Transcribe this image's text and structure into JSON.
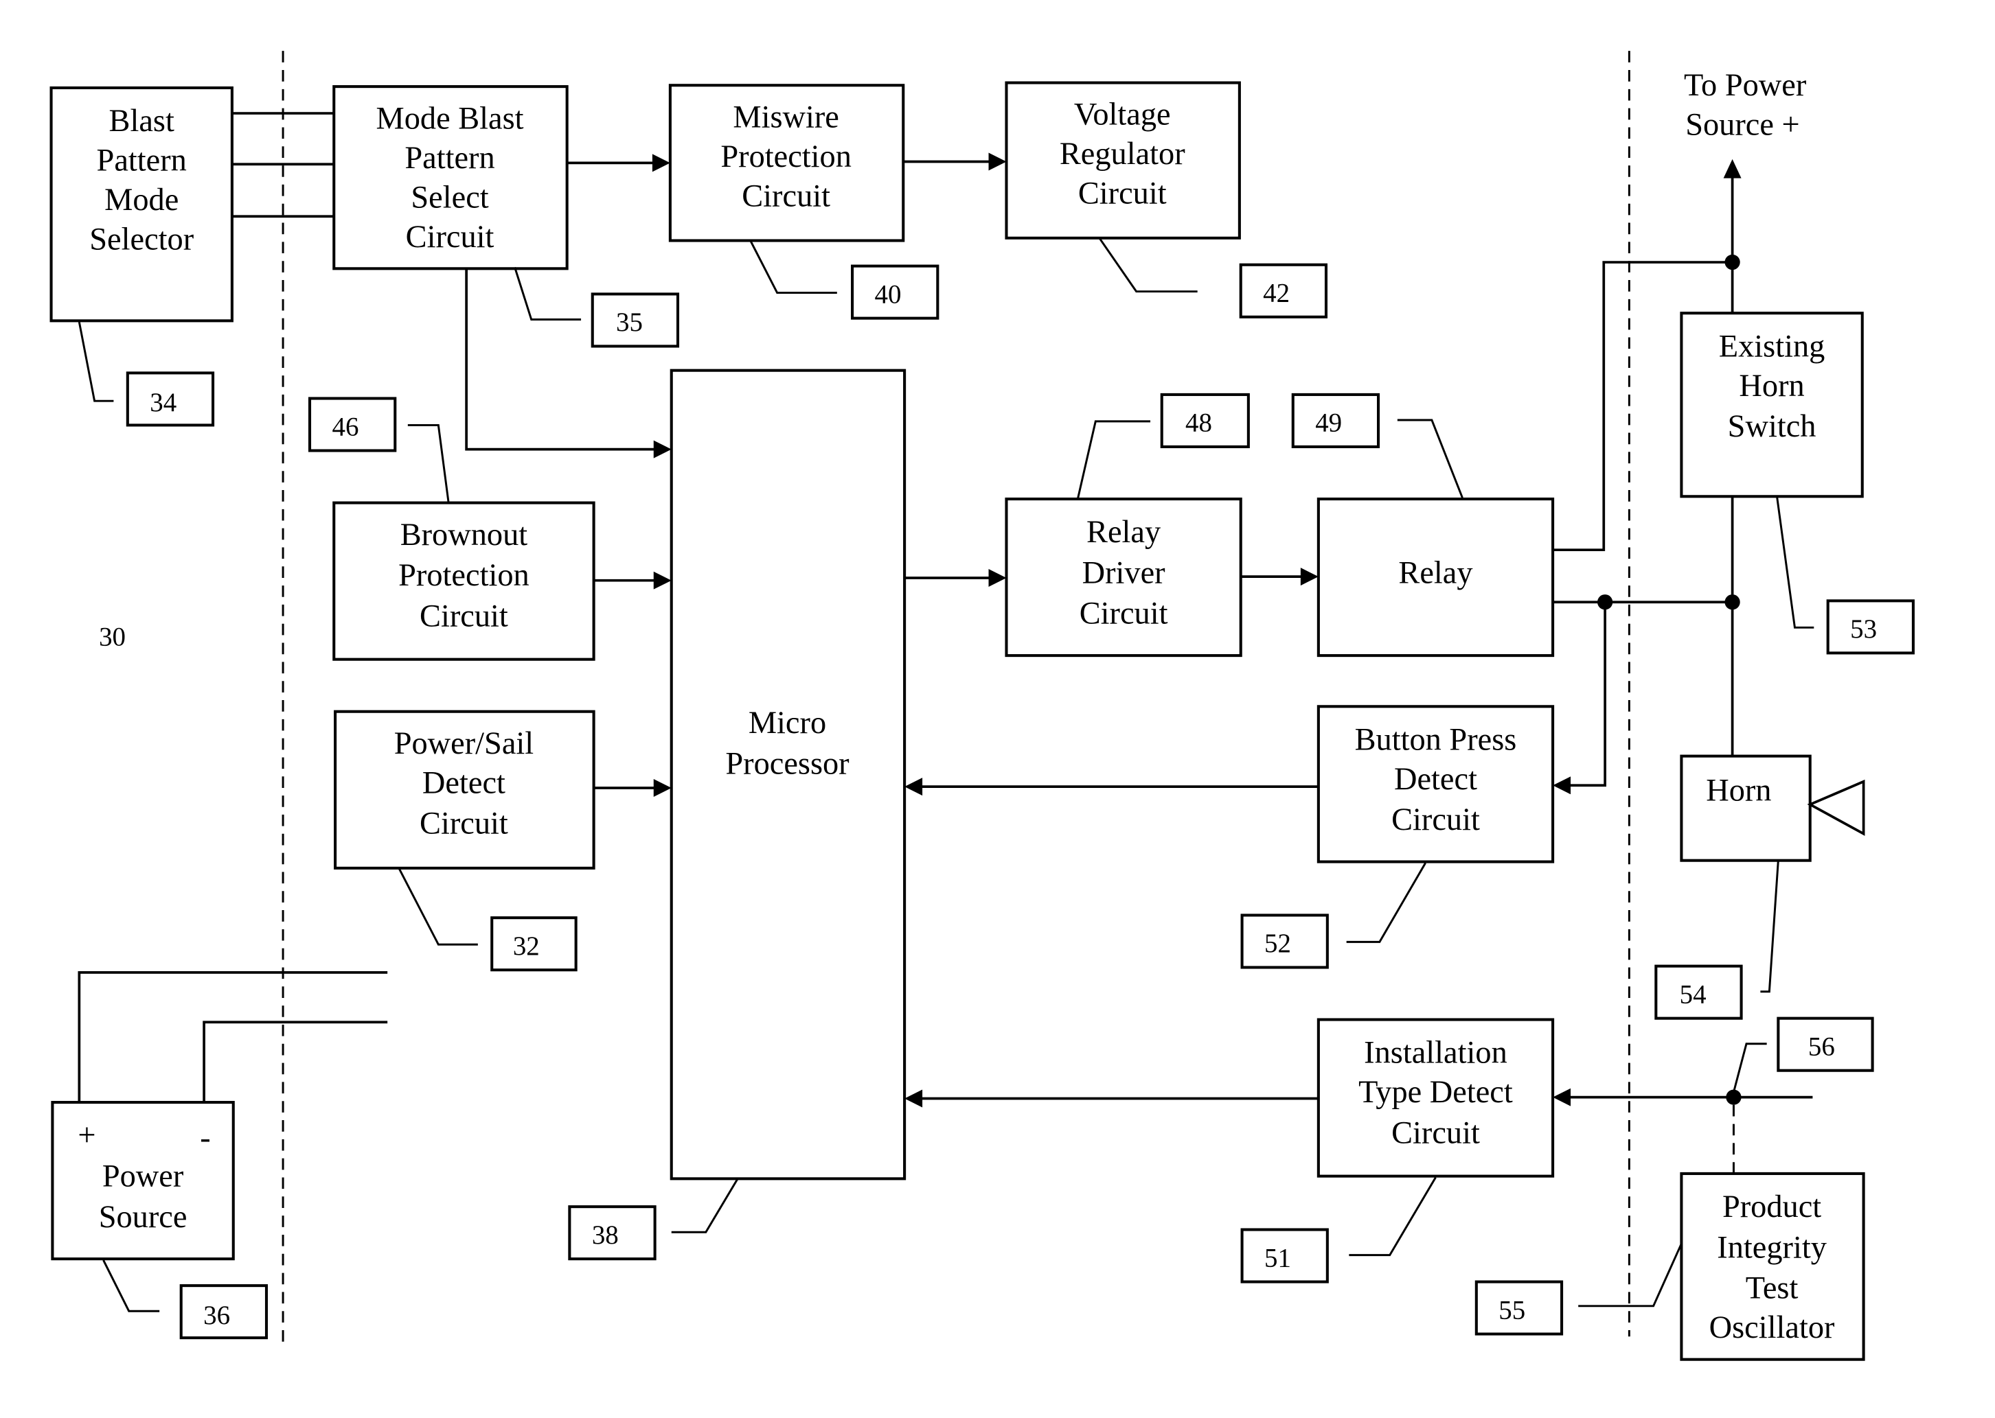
{
  "figure_number": "30",
  "blocks": {
    "blast_pattern_mode_selector": [
      "Blast",
      "Pattern",
      "Mode",
      "Selector"
    ],
    "mode_blast_pattern_select": [
      "Mode Blast",
      "Pattern",
      "Select",
      "Circuit"
    ],
    "miswire_protection": [
      "Miswire",
      "Protection",
      "Circuit"
    ],
    "voltage_regulator": [
      "Voltage",
      "Regulator",
      "Circuit"
    ],
    "brownout_protection": [
      "Brownout",
      "Protection",
      "Circuit"
    ],
    "power_sail_detect": [
      "Power/Sail",
      "Detect",
      "Circuit"
    ],
    "micro_processor": [
      "Micro",
      "Processor"
    ],
    "relay_driver": [
      "Relay",
      "Driver",
      "Circuit"
    ],
    "relay": [
      "Relay"
    ],
    "button_press_detect": [
      "Button Press",
      "Detect",
      "Circuit"
    ],
    "installation_type_detect": [
      "Installation",
      "Type Detect",
      "Circuit"
    ],
    "existing_horn_switch": [
      "Existing",
      "Horn",
      "Switch"
    ],
    "horn": [
      "Horn"
    ],
    "product_integrity_test_oscillator": [
      "Product",
      "Integrity",
      "Test",
      "Oscillator"
    ],
    "power_source": [
      "Power",
      "Source"
    ]
  },
  "power_source_terminals": {
    "plus": "+",
    "minus": "-"
  },
  "to_power_source": [
    "To Power",
    "Source +"
  ],
  "reference_numbers": {
    "n32": "32",
    "n34": "34",
    "n35": "35",
    "n36": "36",
    "n38": "38",
    "n40": "40",
    "n42": "42",
    "n46": "46",
    "n48": "48",
    "n49": "49",
    "n51": "51",
    "n52": "52",
    "n53": "53",
    "n54": "54",
    "n55": "55",
    "n56": "56"
  }
}
